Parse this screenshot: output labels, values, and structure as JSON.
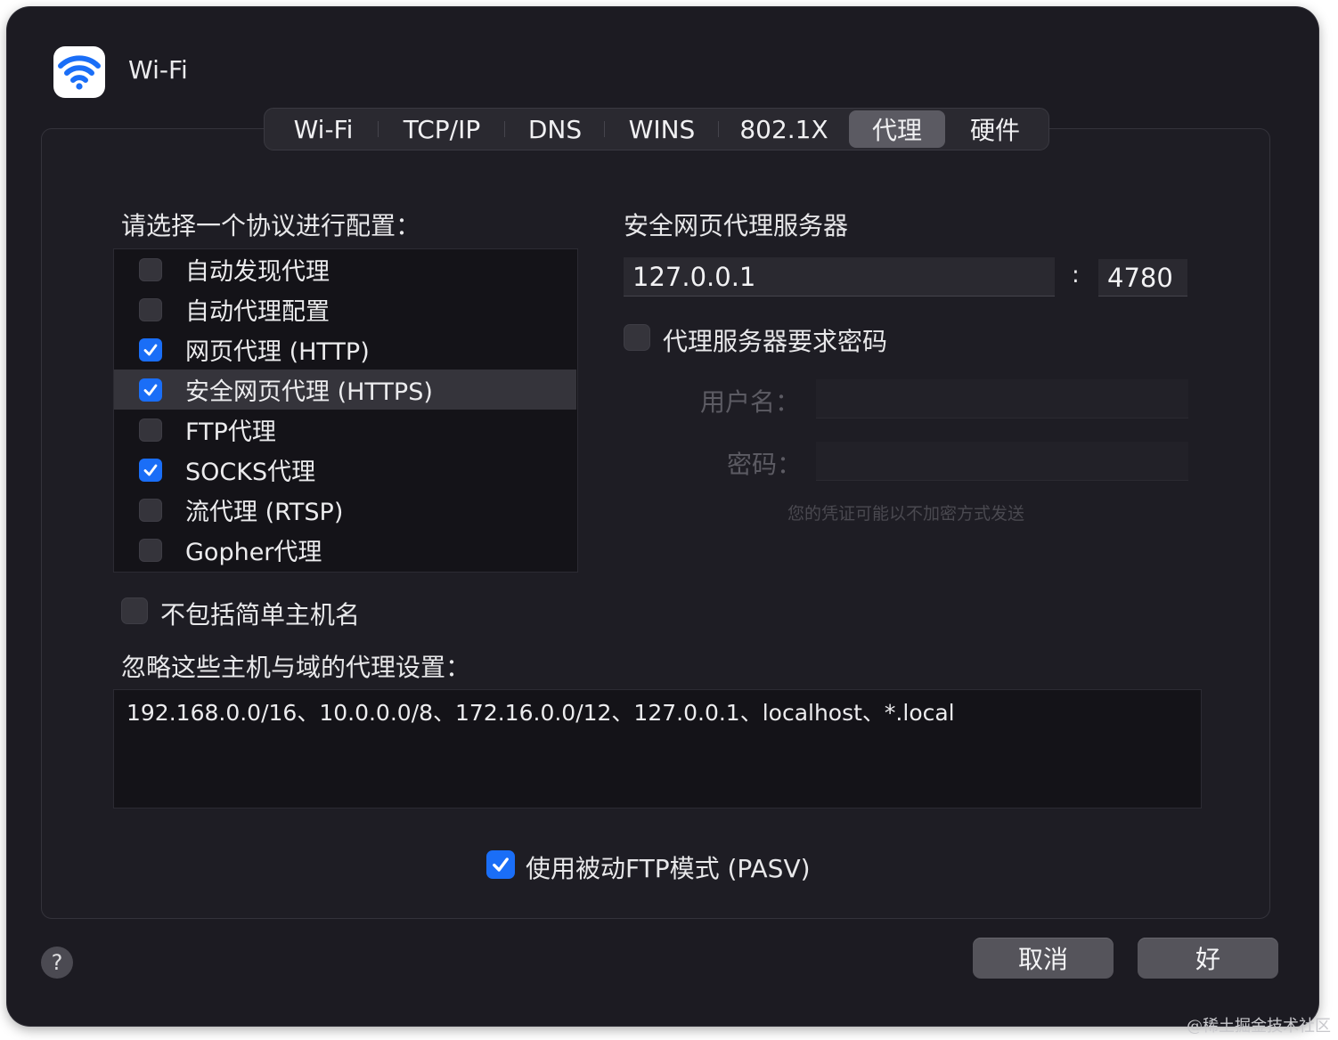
{
  "window": {
    "title": "Wi-Fi",
    "app_icon": "wifi-icon",
    "accent_color": "#1a6ef7"
  },
  "tabs": [
    {
      "label": "Wi-Fi",
      "active": false
    },
    {
      "label": "TCP/IP",
      "active": false
    },
    {
      "label": "DNS",
      "active": false
    },
    {
      "label": "WINS",
      "active": false
    },
    {
      "label": "802.1X",
      "active": false
    },
    {
      "label": "代理",
      "active": true
    },
    {
      "label": "硬件",
      "active": false
    }
  ],
  "protocol_section": {
    "heading": "请选择一个协议进行配置：",
    "items": [
      {
        "label": "自动发现代理",
        "checked": false,
        "selected": false
      },
      {
        "label": "自动代理配置",
        "checked": false,
        "selected": false
      },
      {
        "label": "网页代理 (HTTP)",
        "checked": true,
        "selected": false
      },
      {
        "label": "安全网页代理 (HTTPS)",
        "checked": true,
        "selected": true
      },
      {
        "label": "FTP代理",
        "checked": false,
        "selected": false
      },
      {
        "label": "SOCKS代理",
        "checked": true,
        "selected": false
      },
      {
        "label": "流代理 (RTSP)",
        "checked": false,
        "selected": false
      },
      {
        "label": "Gopher代理",
        "checked": false,
        "selected": false
      }
    ]
  },
  "server_section": {
    "heading": "安全网页代理服务器",
    "host": "127.0.0.1",
    "separator": ":",
    "port": "4780",
    "password_required_label": "代理服务器要求密码",
    "password_required": false,
    "username_label": "用户名：",
    "username_value": "",
    "password_label": "密码：",
    "password_value": "",
    "credentials_note": "您的凭证可能以不加密方式发送"
  },
  "exclude_simple_hostnames": {
    "label": "不包括简单主机名",
    "checked": false
  },
  "bypass": {
    "heading": "忽略这些主机与域的代理设置：",
    "value": "192.168.0.0/16、10.0.0.0/8、172.16.0.0/12、127.0.0.1、localhost、*.local"
  },
  "passive_ftp": {
    "label": "使用被动FTP模式 (PASV)",
    "checked": true
  },
  "footer": {
    "help_label": "?",
    "cancel_label": "取消",
    "ok_label": "好"
  },
  "watermark": "@稀土掘金技术社区"
}
